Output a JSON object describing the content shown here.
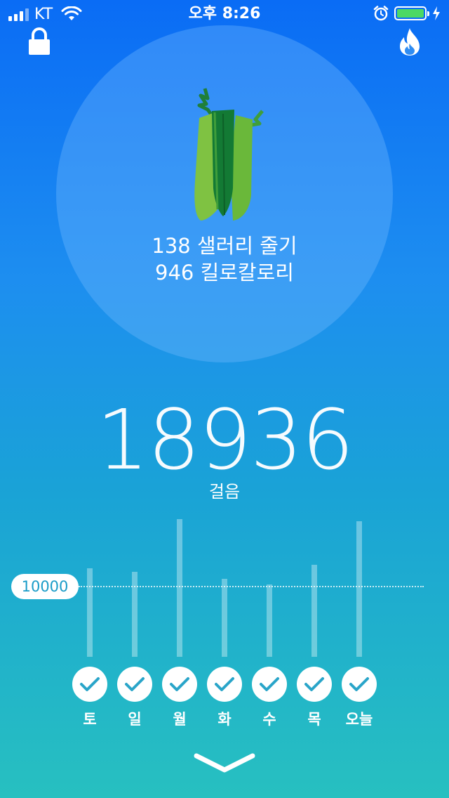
{
  "status_bar": {
    "carrier": "KT",
    "time": "오후 8:26",
    "battery_level": 1.0,
    "icons": [
      "signal-icon",
      "wifi-icon",
      "alarm-icon",
      "battery-icon",
      "charging-icon"
    ]
  },
  "header": {
    "left_icon": "lock-icon",
    "right_icon": "flame-icon"
  },
  "summary": {
    "icon": "celery-icon",
    "line1": "138 샐러리 줄기",
    "line2": "946 킬로칼로리"
  },
  "steps": {
    "count": "18936",
    "label": "걸음"
  },
  "chart_data": {
    "type": "bar",
    "goal_label": "10000",
    "goal": 10000,
    "categories": [
      "토",
      "일",
      "월",
      "화",
      "수",
      "목",
      "오늘"
    ],
    "values": [
      12500,
      12000,
      19400,
      11000,
      10200,
      13000,
      19100
    ],
    "completed": [
      true,
      true,
      true,
      true,
      true,
      true,
      true
    ]
  },
  "colors": {
    "gradient_top": "#0a6cf5",
    "gradient_bottom": "#27c0c0",
    "check_color": "#2aa5c9",
    "battery_fill": "#4cd964"
  },
  "footer": {
    "icon": "chevron-down-icon"
  }
}
